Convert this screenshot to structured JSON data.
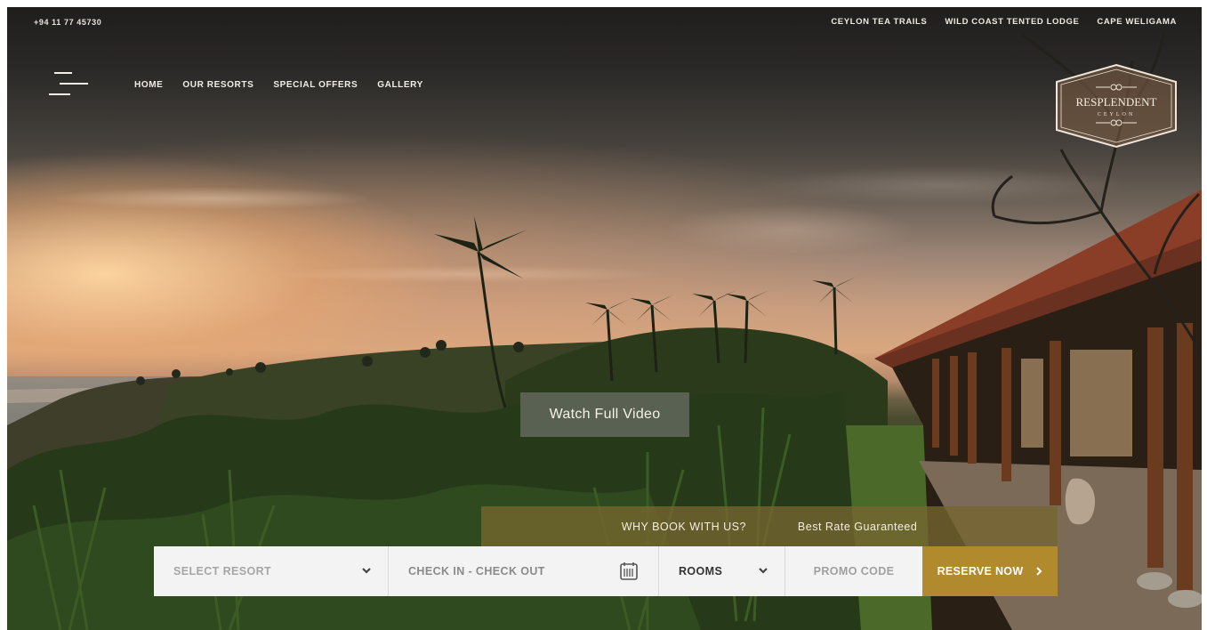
{
  "topbar": {
    "phone": "+94 11 77 45730",
    "links": [
      "CEYLON TEA TRAILS",
      "WILD COAST TENTED LODGE",
      "CAPE WELIGAMA"
    ]
  },
  "nav": {
    "menu_icon": "hamburger-menu-icon",
    "items": [
      "HOME",
      "OUR RESORTS",
      "SPECIAL OFFERS",
      "GALLERY"
    ]
  },
  "logo": {
    "name": "RESPLENDENT",
    "sub": "CEYLON"
  },
  "hero": {
    "video_label": "Watch Full Video"
  },
  "booking": {
    "why_label": "WHY BOOK WITH US?",
    "rate_label": "Best Rate Guaranteed",
    "resort_placeholder": "SELECT RESORT",
    "dates_placeholder": "CHECK IN - CHECK OUT",
    "rooms_label": "ROOMS",
    "promo_placeholder": "PROMO CODE",
    "reserve_label": "RESERVE NOW",
    "reserve_icon": "chevron-right-icon",
    "calendar_icon": "calendar-icon",
    "dropdown_icon": "chevron-down-icon"
  },
  "colors": {
    "gold": "#b08a2c",
    "gold_bar": "#766630",
    "field_bg": "#f3f3f3"
  }
}
